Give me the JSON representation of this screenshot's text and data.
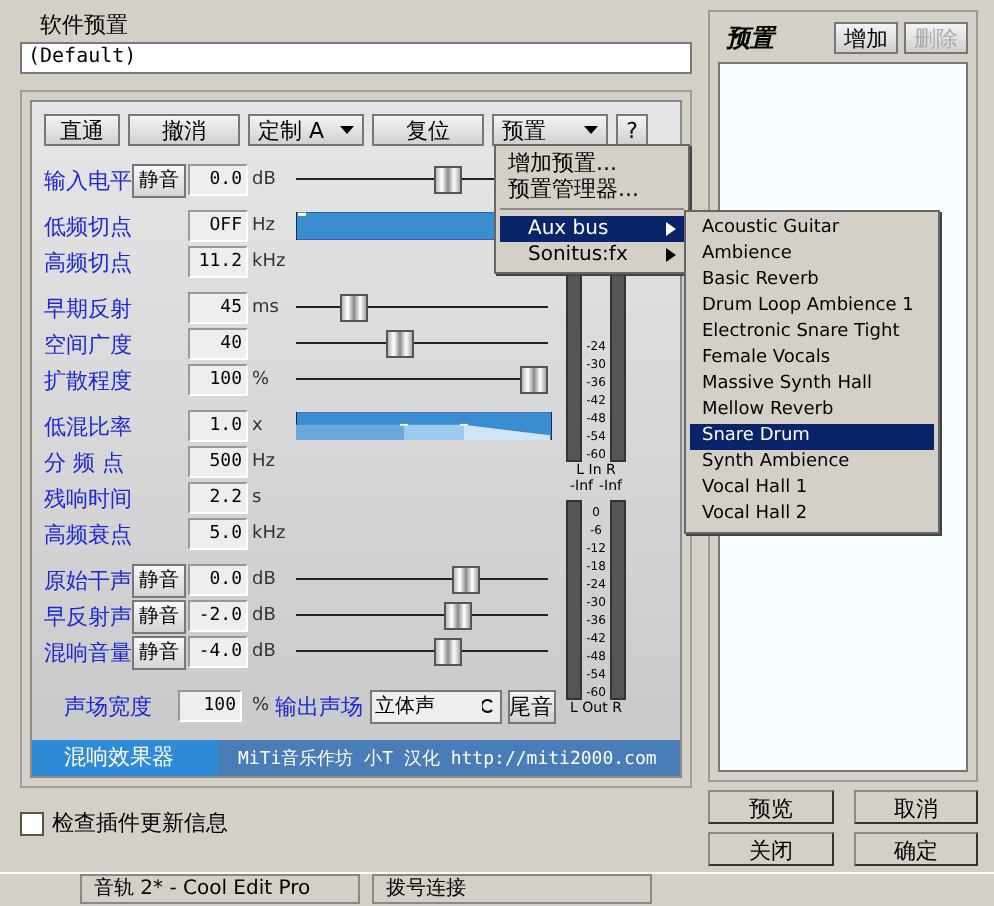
{
  "software_preset": {
    "label": "软件预置",
    "value": "(Default)"
  },
  "toolbar": [
    {
      "label": "直通",
      "kind": "button"
    },
    {
      "label": "撤消",
      "kind": "button"
    },
    {
      "label": "定制 A",
      "kind": "select"
    },
    {
      "label": "复位",
      "kind": "button"
    },
    {
      "label": "预置",
      "kind": "select"
    },
    {
      "label": "?",
      "kind": "button"
    }
  ],
  "groups": [
    {
      "kind": "sliders",
      "rows": [
        {
          "label": "输入电平",
          "mute": "静音",
          "value": "0.0",
          "unit": "dB",
          "level": 0.62
        }
      ]
    },
    {
      "kind": "filter_graph",
      "rows": [
        {
          "label": "低频切点",
          "value": "OFF",
          "unit": "Hz"
        },
        {
          "label": "高频切点",
          "value": "11.2",
          "unit": "kHz"
        }
      ]
    },
    {
      "kind": "sliders",
      "rows": [
        {
          "label": "早期反射",
          "value": "45",
          "unit": "ms",
          "level": 0.2
        },
        {
          "label": "空间广度",
          "value": "40",
          "level": 0.4
        },
        {
          "label": "扩散程度",
          "value": "100",
          "unit": "%",
          "level": 1
        }
      ]
    },
    {
      "kind": "decay_graph",
      "rows": [
        {
          "label": "低混比率",
          "value": "1.0",
          "unit": "x"
        },
        {
          "label": "分 频 点",
          "value": "500",
          "unit": "Hz"
        },
        {
          "label": "残响时间",
          "value": "2.2",
          "unit": "s"
        },
        {
          "label": "高频衰点",
          "value": "5.0",
          "unit": "kHz"
        }
      ]
    },
    {
      "kind": "sliders",
      "rows": [
        {
          "label": "原始干声",
          "mute": "静音",
          "value": "0.0",
          "unit": "dB",
          "level": 0.7
        },
        {
          "label": "早反射声",
          "mute": "静音",
          "value": "-2.0",
          "unit": "dB",
          "level": 0.66
        },
        {
          "label": "混响音量",
          "mute": "静音",
          "value": "-4.0",
          "unit": "dB",
          "level": 0.62
        }
      ]
    }
  ],
  "stereo": {
    "label": "声场宽度",
    "value": "100",
    "unit": "%",
    "output_label": "输出声场",
    "output_value": "立体声",
    "tail_button": "尾音"
  },
  "meters": {
    "in_scale": [
      "-24",
      "-30",
      "-36",
      "-42",
      "-48",
      "-54",
      "-60"
    ],
    "in_caption": "L In R",
    "in_readings": [
      "-Inf",
      "-Inf"
    ],
    "out_scale": [
      "0",
      "-6",
      "-12",
      "-18",
      "-24",
      "-30",
      "-36",
      "-42",
      "-48",
      "-54",
      "-60"
    ],
    "out_caption": "L Out R"
  },
  "banner": {
    "tab": "混响效果器",
    "credit": "MiTi音乐作坊 小T 汉化 http://miti2000.com"
  },
  "preset_menu": {
    "items": [
      "增加预置...",
      "预置管理器..."
    ],
    "submenus": [
      {
        "label": "Aux bus",
        "selected": true
      },
      {
        "label": "Sonitus:fx",
        "selected": false
      }
    ]
  },
  "submenu": [
    {
      "label": "Acoustic Guitar",
      "selected": false
    },
    {
      "label": "Ambience",
      "selected": false
    },
    {
      "label": "Basic Reverb",
      "selected": false
    },
    {
      "label": "Drum Loop Ambience 1",
      "selected": false
    },
    {
      "label": "Electronic Snare Tight",
      "selected": false
    },
    {
      "label": "Female Vocals",
      "selected": false
    },
    {
      "label": "Massive Synth Hall",
      "selected": false
    },
    {
      "label": "Mellow Reverb",
      "selected": false
    },
    {
      "label": "Snare Drum",
      "selected": true
    },
    {
      "label": "Synth Ambience",
      "selected": false
    },
    {
      "label": "Vocal Hall 1",
      "selected": false
    },
    {
      "label": "Vocal Hall 2",
      "selected": false
    }
  ],
  "check_updates": {
    "label": "检查插件更新信息",
    "checked": false
  },
  "presets_panel": {
    "title": "预置",
    "buttons": [
      {
        "label": "增加",
        "disabled": false
      },
      {
        "label": "删除",
        "disabled": true
      }
    ]
  },
  "dialog_buttons": [
    "预览",
    "取消",
    "关闭",
    "确定"
  ],
  "taskbar": [
    {
      "label": "音轨 2* - Cool Edit Pro"
    },
    {
      "label": "拨号连接"
    }
  ]
}
